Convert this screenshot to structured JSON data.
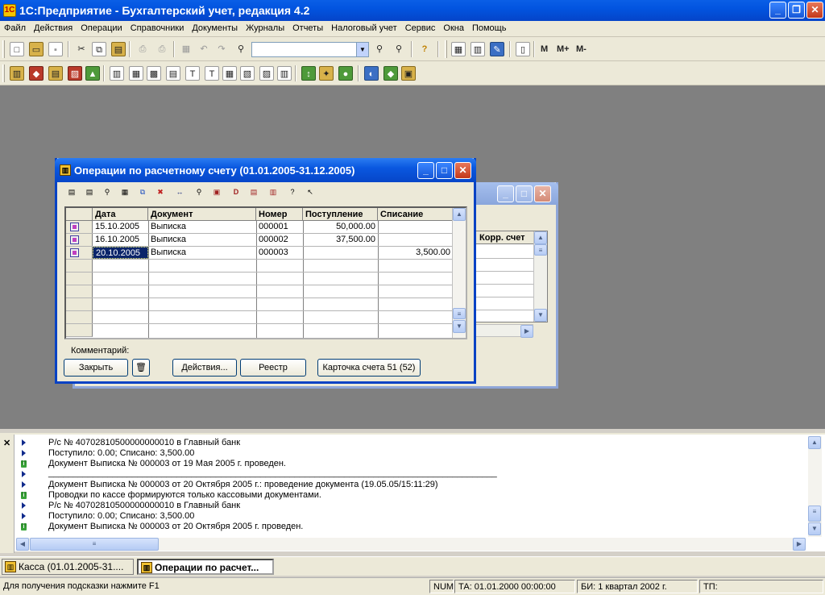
{
  "app": {
    "title": "1С:Предприятие - Бухгалтерский учет, редакция 4.2",
    "icon": "1c-logo-icon"
  },
  "menu": [
    "Файл",
    "Действия",
    "Операции",
    "Справочники",
    "Документы",
    "Журналы",
    "Отчеты",
    "Налоговый учет",
    "Сервис",
    "Окна",
    "Помощь"
  ],
  "toolbar": {
    "m_label": "M",
    "mplus_label": "M+",
    "mminus_label": "M-"
  },
  "front_window": {
    "title": "Операции по расчетному счету (01.01.2005-31.12.2005)",
    "columns": [
      "Дата",
      "Документ",
      "Номер",
      "Поступление",
      "Списание"
    ],
    "rows": [
      {
        "date": "15.10.2005",
        "doc": "Выписка",
        "num": "000001",
        "income": "50,000.00",
        "expense": ""
      },
      {
        "date": "16.10.2005",
        "doc": "Выписка",
        "num": "000002",
        "income": "37,500.00",
        "expense": ""
      },
      {
        "date": "20.10.2005",
        "doc": "Выписка",
        "num": "000003",
        "income": "",
        "expense": "3,500.00"
      }
    ],
    "comment_label": "Комментарий:",
    "buttons": {
      "close": "Закрыть",
      "actions": "Действия...",
      "registry": "Реестр",
      "card": "Карточка счета 51 (52)"
    }
  },
  "back_window": {
    "column": "Корр. счет"
  },
  "messages": [
    {
      "icon": "arrow",
      "text": "Р/с № 40702810500000000010 в Главный банк"
    },
    {
      "icon": "arrow",
      "text": "Поступило: 0.00; Списано: 3,500.00"
    },
    {
      "icon": "info",
      "text": "Документ Выписка № 000003 от 19 Мая 2005 г. проведен."
    },
    {
      "icon": "arrow",
      "text": "___________________________________________________________________________________________"
    },
    {
      "icon": "arrow",
      "text": "Документ Выписка № 000003 от 20 Октября 2005 г.: проведение документа (19.05.05/15:11:29)"
    },
    {
      "icon": "info",
      "text": "Проводки по кассе формируются только кассовыми документами."
    },
    {
      "icon": "arrow",
      "text": "Р/с № 40702810500000000010 в Главный банк"
    },
    {
      "icon": "arrow",
      "text": "Поступило: 0.00; Списано: 3,500.00"
    },
    {
      "icon": "info",
      "text": "Документ Выписка № 000003 от 20 Октября 2005 г. проведен."
    }
  ],
  "taskbar": [
    {
      "label": "Касса (01.01.2005-31....",
      "active": false
    },
    {
      "label": "Операции по расчет...",
      "active": true
    }
  ],
  "status": {
    "hint": "Для получения подсказки нажмите F1",
    "num": "NUM",
    "ta": "ТА: 01.01.2000  00:00:00",
    "bi": "БИ: 1 квартал 2002 г.",
    "tp": "ТП:"
  }
}
